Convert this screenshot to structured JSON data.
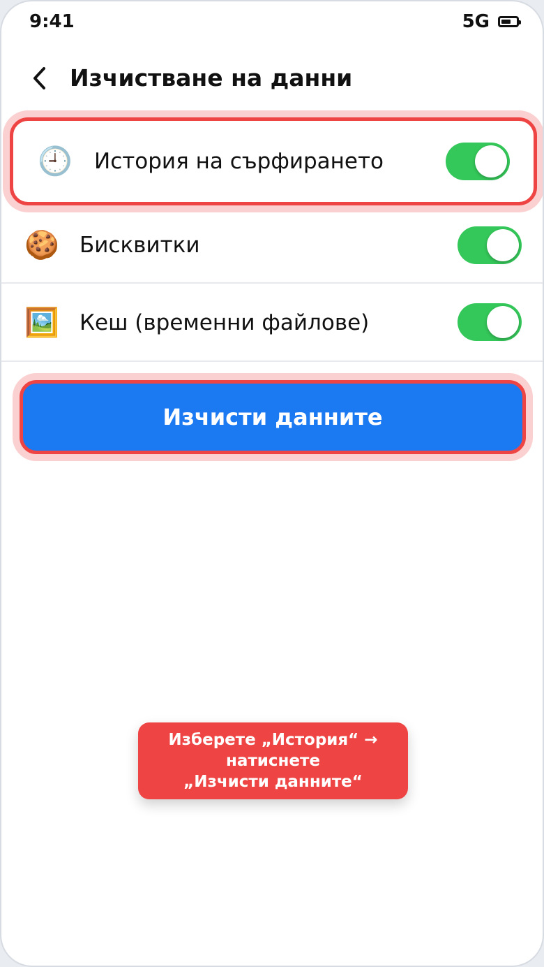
{
  "status_bar": {
    "time": "9:41",
    "network": "5G",
    "battery_icon": "battery-icon"
  },
  "header": {
    "back_icon": "chevron-left-icon",
    "title": "Изчистване на данни"
  },
  "options": [
    {
      "icon": "🕘",
      "icon_name": "clock-icon",
      "label": "История на сърфирането",
      "enabled": true
    },
    {
      "icon": "🍪",
      "icon_name": "cookie-icon",
      "label": "Бисквитки",
      "enabled": true
    },
    {
      "icon": "🖼️",
      "icon_name": "picture-icon",
      "label": "Кеш (временни файлове)",
      "enabled": true
    }
  ],
  "primary_button": {
    "label": "Изчисти данните"
  },
  "instruction": {
    "line1": "Изберете „История“ →",
    "line2": "натиснете",
    "line3": "„Изчисти данните“"
  },
  "colors": {
    "toggle_on": "#34c759",
    "primary": "#1b7af2",
    "highlight": "#ef4444"
  }
}
